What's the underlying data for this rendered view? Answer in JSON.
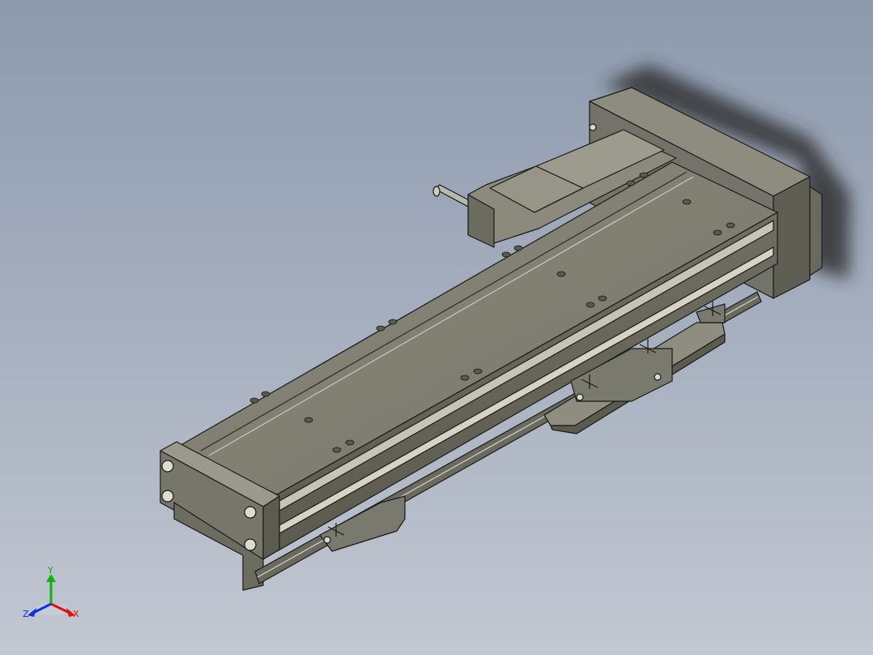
{
  "viewport": {
    "background_top": "#8d9aae",
    "background_bottom": "#c2c8d2",
    "model_color": "#7d7c6e",
    "model_dark": "#4f4e43",
    "model_light": "#a6a596",
    "edge_color": "#1a1a18"
  },
  "triad": {
    "x_label": "X",
    "y_label": "Y",
    "z_label": "Z",
    "x_color": "#e01010",
    "y_color": "#10b010",
    "z_color": "#1030e0"
  }
}
